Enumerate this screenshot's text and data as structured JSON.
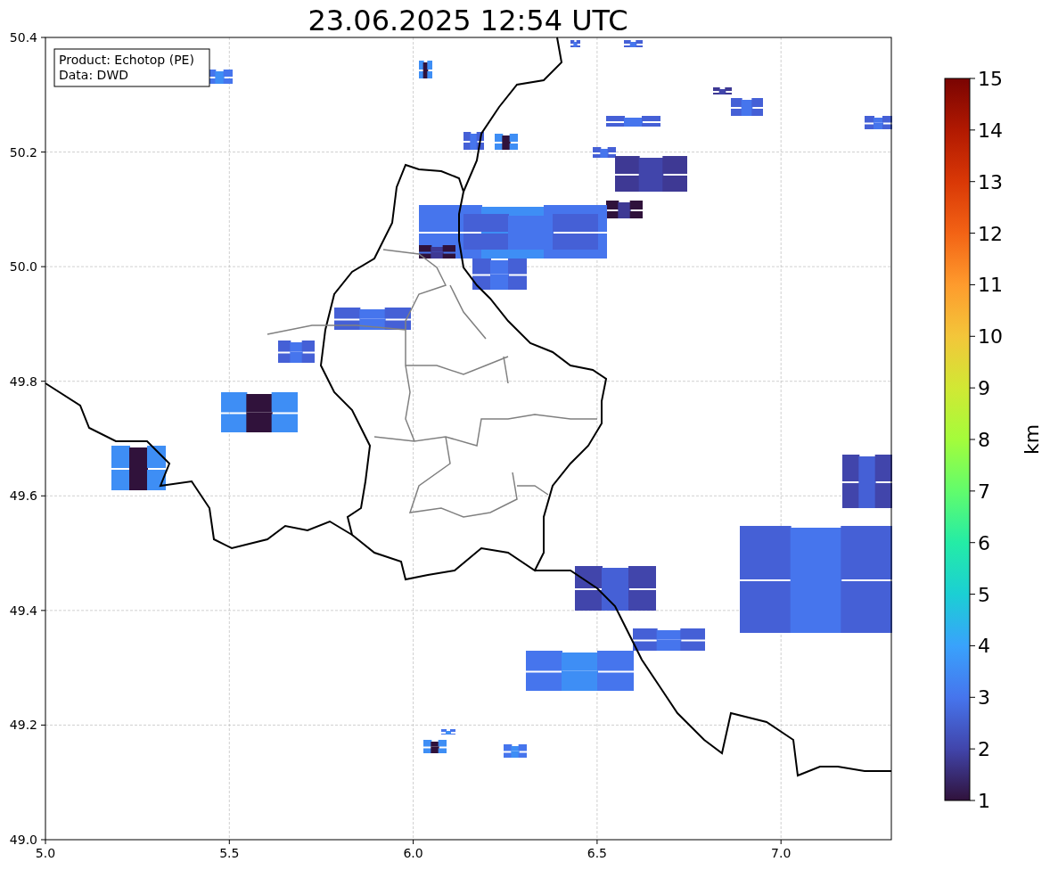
{
  "figure": {
    "title": "23.06.2025 12:54 UTC"
  },
  "map": {
    "info_box": [
      "Product: Echotop (PE)",
      "Data: DWD"
    ],
    "xticks": [
      "5.0",
      "5.5",
      "6.0",
      "6.5",
      "7.0"
    ],
    "yticks": [
      "50.4",
      "50.2",
      "50.0",
      "49.8",
      "49.6",
      "49.4",
      "49.2",
      "49.0"
    ]
  },
  "colorbar": {
    "label": "km",
    "ticks": [
      "15",
      "14",
      "13",
      "12",
      "11",
      "10",
      "9",
      "8",
      "7",
      "6",
      "5",
      "4",
      "3",
      "2",
      "1"
    ]
  }
}
